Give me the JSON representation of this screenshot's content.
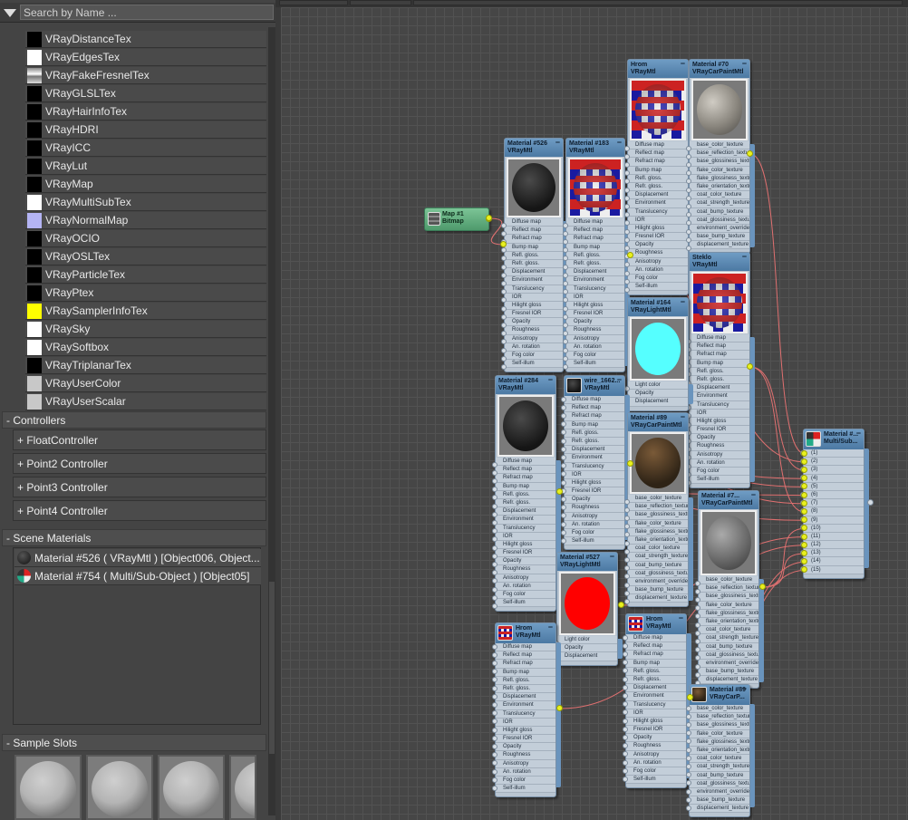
{
  "search": {
    "placeholder": "Search by Name ..."
  },
  "browser_items": [
    {
      "label": "VRayDistanceTex",
      "swatch": "#000000"
    },
    {
      "label": "VRayEdgesTex",
      "swatch": "#ffffff"
    },
    {
      "label": "VRayFakeFresnelTex",
      "swatch": "gradient"
    },
    {
      "label": "VRayGLSLTex",
      "swatch": "#000000"
    },
    {
      "label": "VRayHairInfoTex",
      "swatch": "#000000"
    },
    {
      "label": "VRayHDRI",
      "swatch": "#000000"
    },
    {
      "label": "VRayICC",
      "swatch": "#000000"
    },
    {
      "label": "VRayLut",
      "swatch": "#000000"
    },
    {
      "label": "VRayMap",
      "swatch": "#000000"
    },
    {
      "label": "VRayMultiSubTex",
      "swatch": "#ffffff"
    },
    {
      "label": "VRayNormalMap",
      "swatch": "#b4b4f4"
    },
    {
      "label": "VRayOCIO",
      "swatch": "#000000"
    },
    {
      "label": "VRayOSLTex",
      "swatch": "#000000"
    },
    {
      "label": "VRayParticleTex",
      "swatch": "#000000"
    },
    {
      "label": "VRayPtex",
      "swatch": "#000000"
    },
    {
      "label": "VRaySamplerInfoTex",
      "swatch": "#ffff00"
    },
    {
      "label": "VRaySky",
      "swatch": "#ffffff"
    },
    {
      "label": "VRaySoftbox",
      "swatch": "#ffffff"
    },
    {
      "label": "VRayTriplanarTex",
      "swatch": "#000000"
    },
    {
      "label": "VRayUserColor",
      "swatch": "#c8c8c8"
    },
    {
      "label": "VRayUserScalar",
      "swatch": "#c8c8c8"
    }
  ],
  "controllers": {
    "header": "-  Controllers",
    "items": [
      "+ FloatController",
      "+ Point2 Controller",
      "+ Point3 Controller",
      "+ Point4 Controller"
    ]
  },
  "scene_materials": {
    "header": "-  Scene Materials",
    "items": [
      {
        "label": "Material #526  ( VRayMtl )  [Object006, Object...",
        "icon": "dark-sphere"
      },
      {
        "label": "Material #754  ( Multi/Sub-Object )  [Object05]",
        "icon": "multi-sub"
      }
    ]
  },
  "sample_slots": {
    "header": "-  Sample Slots",
    "count": 4
  },
  "slot_sets": {
    "vray": [
      "Diffuse map",
      "Reflect map",
      "Refract map",
      "Bump map",
      "Refl. gloss.",
      "Refr. gloss.",
      "Displacement",
      "Environment",
      "Translucency",
      "IOR",
      "Hilight gloss",
      "Fresnel IOR",
      "Opacity",
      "Roughness",
      "Anisotropy",
      "An. rotation",
      "Fog color",
      "Self-illum"
    ],
    "carpaint": [
      "base_color_texture",
      "base_reflection_texture",
      "base_glossiness_texture",
      "flake_color_texture",
      "flake_glossiness_texture",
      "flake_orientation_texture",
      "coat_color_texture",
      "coat_strength_texture",
      "coat_bump_texture",
      "coat_glossiness_texture",
      "environment_override_te...",
      "base_bump_texture",
      "displacement_texture"
    ],
    "light": [
      "Light color",
      "Opacity",
      "Displacement"
    ],
    "multisub": [
      "(1)",
      "(2)",
      "(3)",
      "(4)",
      "(5)",
      "(6)",
      "(7)",
      "(8)",
      "(9)",
      "(10)",
      "(11)",
      "(12)",
      "(13)",
      "(14)",
      "(15)"
    ]
  },
  "nodes": [
    {
      "title": "Map #1",
      "type": "Bitmap",
      "preview": "bitmap",
      "slots": "none"
    },
    {
      "title": "Material #526",
      "type": "VRayMtl",
      "preview": "dark",
      "slots": "vray"
    },
    {
      "title": "Material #183",
      "type": "VRayMtl",
      "preview": "checker",
      "slots": "vray"
    },
    {
      "title": "Hrom",
      "type": "VRayMtl",
      "preview": "checker",
      "slots": "vray"
    },
    {
      "title": "Material #70",
      "type": "VRayCarPaintMtl",
      "preview": "grey",
      "slots": "carpaint"
    },
    {
      "title": "Steklo",
      "type": "VRayMtl",
      "preview": "checker",
      "slots": "vray"
    },
    {
      "title": "Material #164",
      "type": "VRayLightMtl",
      "preview": "cyan",
      "slots": "light"
    },
    {
      "title": "Material #284",
      "type": "VRayMtl",
      "preview": "dark",
      "slots": "vray"
    },
    {
      "title": "wire_1662...",
      "type": "VRayMtl",
      "preview": "icon-dark",
      "slots": "vray"
    },
    {
      "title": "Material #89",
      "type": "VRayCarPaintMtl",
      "preview": "brown",
      "slots": "carpaint"
    },
    {
      "title": "Material #527",
      "type": "VRayLightMtl",
      "preview": "red",
      "slots": "light"
    },
    {
      "title": "Material #7...",
      "type": "VRayCarPaintMtl",
      "preview": "grey2",
      "slots": "carpaint"
    },
    {
      "title": "Hrom",
      "type": "VRayMtl",
      "preview": "icon-checker",
      "slots": "vray"
    },
    {
      "title": "Hrom",
      "type": "VRayMtl",
      "preview": "icon-checker",
      "slots": "vray"
    },
    {
      "title": "Material #89",
      "type": "VRayCarP...",
      "preview": "icon-brown",
      "slots": "carpaint"
    },
    {
      "title": "Material #...",
      "type": "Multi/Sub...",
      "preview": "icon-multi",
      "slots": "multisub"
    }
  ],
  "colors": {
    "wire": "#e07070",
    "socket_connected": "#e8f020",
    "node_header": "#5a88b2",
    "bitmap_node": "#5fae7e"
  }
}
